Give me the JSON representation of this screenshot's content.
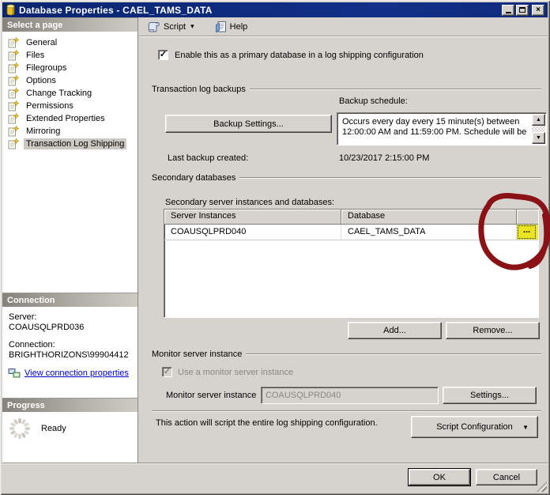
{
  "window": {
    "title": "Database Properties - CAEL_TAMS_DATA"
  },
  "icons": {
    "close": "×",
    "dropdown": "▾",
    "combo_arrow": "▼",
    "scroll_up": "▲",
    "scroll_down": "▼",
    "check": "✓"
  },
  "toolbar": {
    "script_label": "Script",
    "help_label": "Help"
  },
  "sidebar": {
    "select_page_header": "Select a page",
    "pages": [
      {
        "label": "General"
      },
      {
        "label": "Files"
      },
      {
        "label": "Filegroups"
      },
      {
        "label": "Options"
      },
      {
        "label": "Change Tracking"
      },
      {
        "label": "Permissions"
      },
      {
        "label": "Extended Properties"
      },
      {
        "label": "Mirroring"
      },
      {
        "label": "Transaction Log Shipping"
      }
    ],
    "connection_header": "Connection",
    "server_label": "Server:",
    "server_value": "COAUSQLPRD036",
    "connection_label": "Connection:",
    "connection_value": "BRIGHTHORIZONS\\99904412",
    "view_connection_link": "View connection properties",
    "progress_header": "Progress",
    "progress_status": "Ready"
  },
  "main": {
    "enable_checkbox_label": "Enable this as a primary database in a log shipping configuration",
    "backups": {
      "title": "Transaction log backups",
      "backup_settings_button": "Backup Settings...",
      "backup_schedule_label": "Backup schedule:",
      "schedule_text": "Occurs every day every 15 minute(s) between 12:00:00 AM and 11:59:00 PM. Schedule will be",
      "last_backup_label": "Last backup created:",
      "last_backup_value": "10/23/2017 2:15:00 PM"
    },
    "secondary": {
      "title": "Secondary databases",
      "table_label": "Secondary server instances and databases:",
      "columns": [
        "Server Instances",
        "Database"
      ],
      "rows": [
        {
          "server_instance": "COAUSQLPRD040",
          "database": "CAEL_TAMS_DATA",
          "action": "..."
        }
      ],
      "add_button": "Add...",
      "remove_button": "Remove..."
    },
    "monitor": {
      "title": "Monitor server instance",
      "use_monitor_checkbox_label": "Use a monitor server instance",
      "monitor_instance_label": "Monitor server instance",
      "monitor_instance_value": "COAUSQLPRD040",
      "settings_button": "Settings..."
    },
    "script_note": "This action will script the entire log shipping configuration.",
    "script_config_button": "Script Configuration"
  },
  "footer": {
    "ok_button": "OK",
    "cancel_button": "Cancel"
  },
  "colors": {
    "titlebar": "#0d2a7e",
    "dialog_bg": "#d6d3ce",
    "highlight_yellow": "#e9e41f",
    "annotation_red": "#8a1216",
    "link_blue": "#0000cc"
  }
}
